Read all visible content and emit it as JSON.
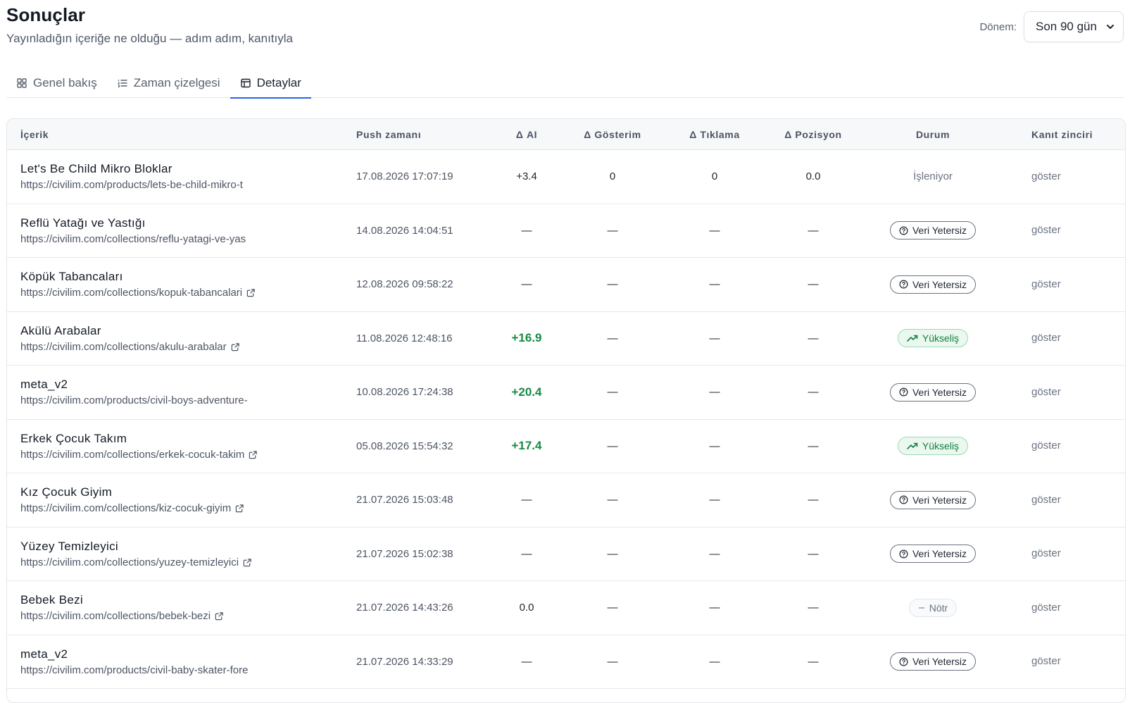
{
  "header": {
    "title": "Sonuçlar",
    "subtitle": "Yayınladığın içeriğe ne olduğu — adım adım, kanıtıyla",
    "period_label": "Dönem:",
    "period_value": "Son 90 gün"
  },
  "tabs": [
    {
      "label": "Genel bakış",
      "icon": "grid-icon",
      "active": false
    },
    {
      "label": "Zaman çizelgesi",
      "icon": "list-ordered-icon",
      "active": false
    },
    {
      "label": "Detaylar",
      "icon": "table-icon",
      "active": true
    }
  ],
  "table": {
    "headers": {
      "content": "İçerik",
      "push": "Push zamanı",
      "ai": "Δ AI",
      "impressions": "Δ Gösterim",
      "clicks": "Δ Tıklama",
      "position": "Δ Pozisyon",
      "status": "Durum",
      "proof": "Kanıt zinciri"
    },
    "rows": [
      {
        "name": "Let's Be Child Mikro Bloklar",
        "url": "https://civilim.com/products/lets-be-child-mikro-t",
        "push": "17.08.2026 17:07:19",
        "ai": "+3.4",
        "impressions": "0",
        "clicks": "0",
        "position": "0.0",
        "status": "İşleniyor",
        "proof": "göster"
      },
      {
        "name": "Reflü Yatağı ve Yastığı",
        "url": "https://civilim.com/collections/reflu-yatagi-ve-yas",
        "push": "14.08.2026 14:04:51",
        "ai": "—",
        "impressions": "—",
        "clicks": "—",
        "position": "—",
        "status": "Veri Yetersiz",
        "proof": "göster"
      },
      {
        "name": "Köpük Tabancaları",
        "url": "https://civilim.com/collections/kopuk-tabancalari",
        "push": "12.08.2026 09:58:22",
        "ai": "—",
        "impressions": "—",
        "clicks": "—",
        "position": "—",
        "status": "Veri Yetersiz",
        "proof": "göster"
      },
      {
        "name": "Akülü Arabalar",
        "url": "https://civilim.com/collections/akulu-arabalar",
        "push": "11.08.2026 12:48:16",
        "ai": "+16.9",
        "impressions": "—",
        "clicks": "—",
        "position": "—",
        "status": "Yükseliş",
        "proof": "göster"
      },
      {
        "name": "meta_v2",
        "url": "https://civilim.com/products/civil-boys-adventure-",
        "push": "10.08.2026 17:24:38",
        "ai": "+20.4",
        "impressions": "—",
        "clicks": "—",
        "position": "—",
        "status": "Veri Yetersiz",
        "proof": "göster"
      },
      {
        "name": "Erkek Çocuk Takım",
        "url": "https://civilim.com/collections/erkek-cocuk-takim",
        "push": "05.08.2026 15:54:32",
        "ai": "+17.4",
        "impressions": "—",
        "clicks": "—",
        "position": "—",
        "status": "Yükseliş",
        "proof": "göster"
      },
      {
        "name": "Kız Çocuk Giyim",
        "url": "https://civilim.com/collections/kiz-cocuk-giyim",
        "push": "21.07.2026 15:03:48",
        "ai": "—",
        "impressions": "—",
        "clicks": "—",
        "position": "—",
        "status": "Veri Yetersiz",
        "proof": "göster"
      },
      {
        "name": "Yüzey Temizleyici",
        "url": "https://civilim.com/collections/yuzey-temizleyici",
        "push": "21.07.2026 15:02:38",
        "ai": "—",
        "impressions": "—",
        "clicks": "—",
        "position": "—",
        "status": "Veri Yetersiz",
        "proof": "göster"
      },
      {
        "name": "Bebek Bezi",
        "url": "https://civilim.com/collections/bebek-bezi",
        "push": "21.07.2026 14:43:26",
        "ai": "0.0",
        "impressions": "—",
        "clicks": "—",
        "position": "—",
        "status": "Nötr",
        "proof": "göster"
      },
      {
        "name": "meta_v2",
        "url": "https://civilim.com/products/civil-baby-skater-fore",
        "push": "21.07.2026 14:33:29",
        "ai": "—",
        "impressions": "—",
        "clicks": "—",
        "position": "—",
        "status": "Veri Yetersiz",
        "proof": "göster"
      }
    ]
  },
  "colors": {
    "accent": "#2563eb",
    "rise": "#188a44",
    "rise_bg": "#eaf8ef"
  }
}
